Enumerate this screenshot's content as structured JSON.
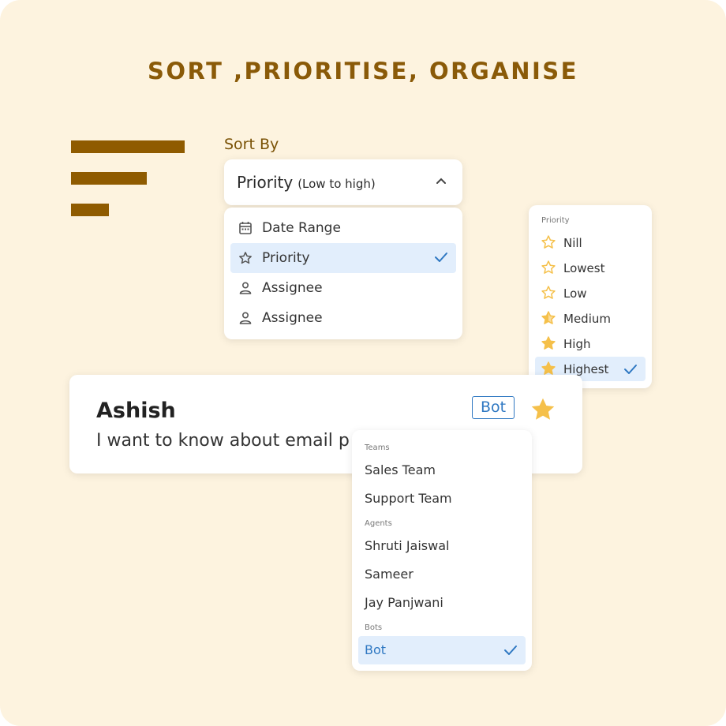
{
  "title": "SORT ,PRIORITISE, ORGANISE",
  "sort": {
    "label": "Sort By",
    "selected_main": "Priority",
    "selected_sub": "(Low to high)",
    "options": [
      {
        "label": "Date Range",
        "icon": "calendar-icon"
      },
      {
        "label": "Priority",
        "icon": "star-outline-icon",
        "selected": true
      },
      {
        "label": "Assignee",
        "icon": "person-icon"
      },
      {
        "label": "Assignee",
        "icon": "person-icon"
      }
    ]
  },
  "priority_menu": {
    "header": "Priority",
    "items": [
      {
        "label": "Nill",
        "fill": 0
      },
      {
        "label": "Lowest",
        "fill": 0
      },
      {
        "label": "Low",
        "fill": 0
      },
      {
        "label": "Medium",
        "fill": 0.5
      },
      {
        "label": "High",
        "fill": 1
      },
      {
        "label": "Highest",
        "fill": 1,
        "selected": true
      }
    ]
  },
  "message": {
    "name": "Ashish",
    "text": "I want to know about  email p",
    "badge": "Bot"
  },
  "assign_menu": {
    "teams_header": "Teams",
    "teams": [
      "Sales Team",
      "Support Team"
    ],
    "agents_header": "Agents",
    "agents": [
      "Shruti Jaiswal",
      "Sameer",
      "Jay Panjwani"
    ],
    "bots_header": "Bots",
    "bots": [
      "Bot"
    ]
  },
  "colors": {
    "background": "#fdf3df",
    "title": "#8a5a08",
    "accent_blue": "#2f78c2",
    "selected_bg": "#e2eefc",
    "star": "#f5c04a"
  }
}
